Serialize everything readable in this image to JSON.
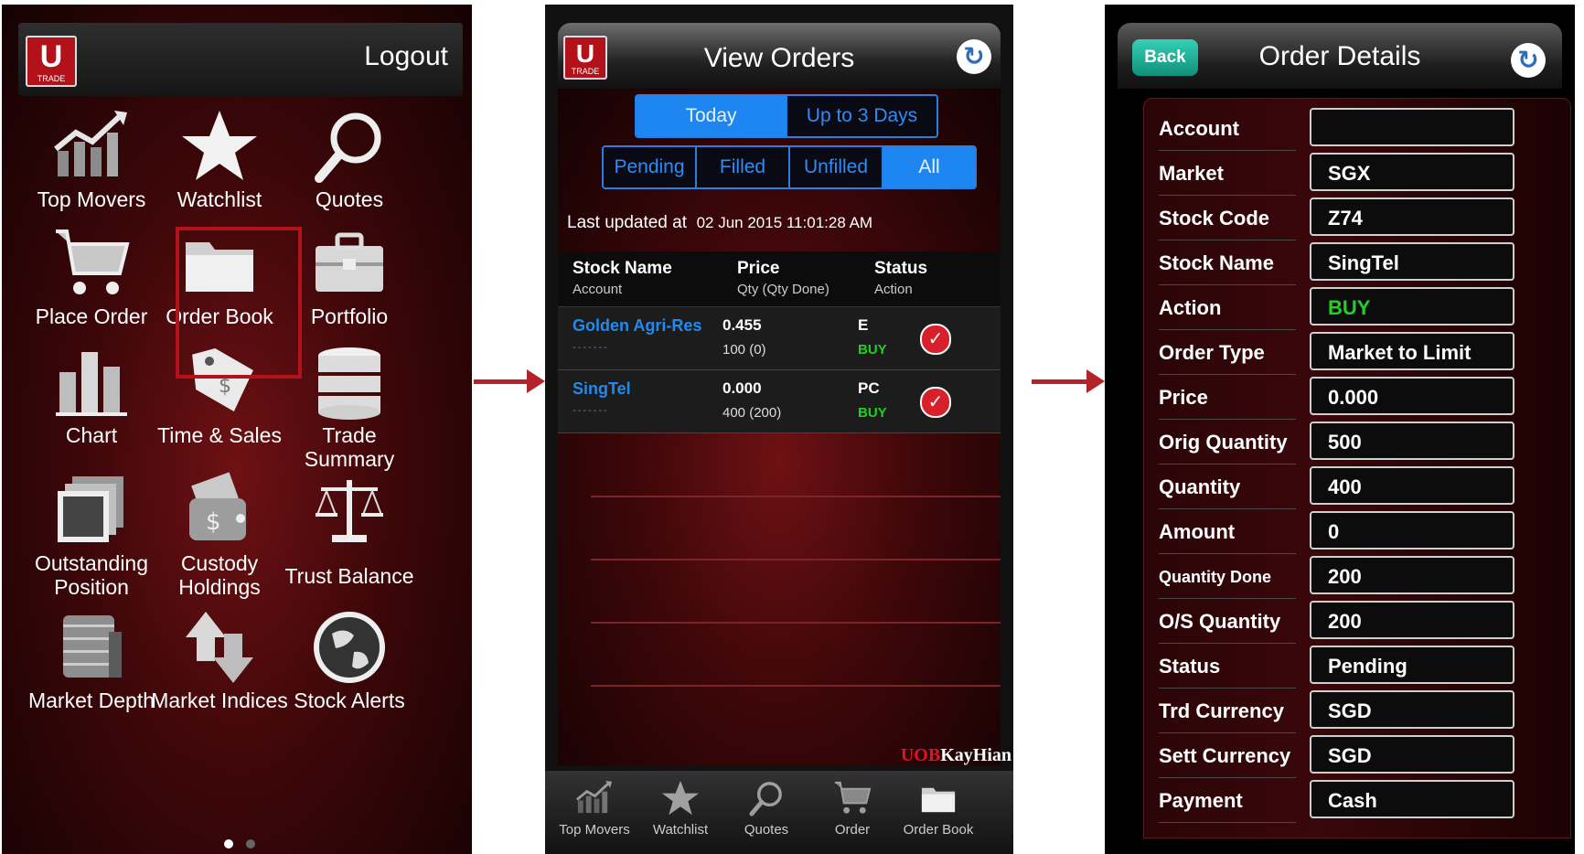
{
  "brand": {
    "logo_letter": "U",
    "logo_sub": "TRADE",
    "company_red": "UOB",
    "company_white": "KayHian",
    "accent": "#b3121a"
  },
  "screen1": {
    "logout": "Logout",
    "menu": [
      {
        "label": "Top Movers",
        "icon": "trend-chart-icon"
      },
      {
        "label": "Watchlist",
        "icon": "star-icon"
      },
      {
        "label": "Quotes",
        "icon": "magnifier-icon"
      },
      {
        "label": "Place Order",
        "icon": "cart-icon"
      },
      {
        "label": "Order Book",
        "icon": "folder-icon"
      },
      {
        "label": "Portfolio",
        "icon": "briefcase-icon"
      },
      {
        "label": "Chart",
        "icon": "bar-chart-icon"
      },
      {
        "label": "Time & Sales",
        "icon": "price-tag-icon"
      },
      {
        "label": "Trade Summary",
        "icon": "database-icon"
      },
      {
        "label": "Outstanding\nPosition",
        "icon": "photo-stack-icon"
      },
      {
        "label": "Custody\nHoldings",
        "icon": "wallet-icon"
      },
      {
        "label": "Trust Balance",
        "icon": "scales-icon"
      },
      {
        "label": "Market Depth",
        "icon": "coins-stack-icon"
      },
      {
        "label": "Market Indices",
        "icon": "up-down-arrows-icon"
      },
      {
        "label": "Stock Alerts",
        "icon": "globe-icon"
      }
    ],
    "highlighted_item": "Order Book",
    "page_indicator": {
      "current": 1,
      "total": 2
    }
  },
  "screen2": {
    "title": "View Orders",
    "date_tabs": [
      {
        "label": "Today",
        "active": true
      },
      {
        "label": "Up to 3 Days",
        "active": false
      }
    ],
    "status_tabs": [
      {
        "label": "Pending",
        "active": false
      },
      {
        "label": "Filled",
        "active": false
      },
      {
        "label": "Unfilled",
        "active": false
      },
      {
        "label": "All",
        "active": true
      }
    ],
    "last_updated_label": "Last updated at",
    "last_updated_value": "02 Jun 2015 11:01:28 AM",
    "columns": [
      {
        "main": "Stock Name",
        "sub": "Account"
      },
      {
        "main": "Price",
        "sub": "Qty (Qty Done)"
      },
      {
        "main": "Status",
        "sub": "Action"
      }
    ],
    "orders": [
      {
        "stock": "Golden Agri-Res",
        "account": "-------",
        "price": "0.455",
        "qty": "100 (0)",
        "status": "E",
        "action": "BUY"
      },
      {
        "stock": "SingTel",
        "account": "-------",
        "price": "0.000",
        "qty": "400 (200)",
        "status": "PC",
        "action": "BUY"
      }
    ],
    "tabbar": [
      {
        "label": "Top Movers",
        "icon": "trend-chart-icon"
      },
      {
        "label": "Watchlist",
        "icon": "star-icon"
      },
      {
        "label": "Quotes",
        "icon": "magnifier-icon"
      },
      {
        "label": "Order",
        "icon": "cart-icon"
      },
      {
        "label": "Order Book",
        "icon": "folder-icon"
      }
    ]
  },
  "screen3": {
    "back": "Back",
    "title": "Order Details",
    "fields": [
      {
        "label": "Account",
        "value": ""
      },
      {
        "label": "Market",
        "value": "SGX"
      },
      {
        "label": "Stock Code",
        "value": "Z74"
      },
      {
        "label": "Stock Name",
        "value": "SingTel"
      },
      {
        "label": "Action",
        "value": "BUY"
      },
      {
        "label": "Order Type",
        "value": "Market to Limit"
      },
      {
        "label": "Price",
        "value": "0.000"
      },
      {
        "label": "Orig Quantity",
        "value": "500"
      },
      {
        "label": "Quantity",
        "value": "400"
      },
      {
        "label": "Amount",
        "value": "0"
      },
      {
        "label": "Quantity Done",
        "value": "200"
      },
      {
        "label": "O/S Quantity",
        "value": "200"
      },
      {
        "label": "Status",
        "value": "Pending"
      },
      {
        "label": "Trd Currency",
        "value": "SGD"
      },
      {
        "label": "Sett Currency",
        "value": "SGD"
      },
      {
        "label": "Payment",
        "value": "Cash"
      }
    ]
  }
}
